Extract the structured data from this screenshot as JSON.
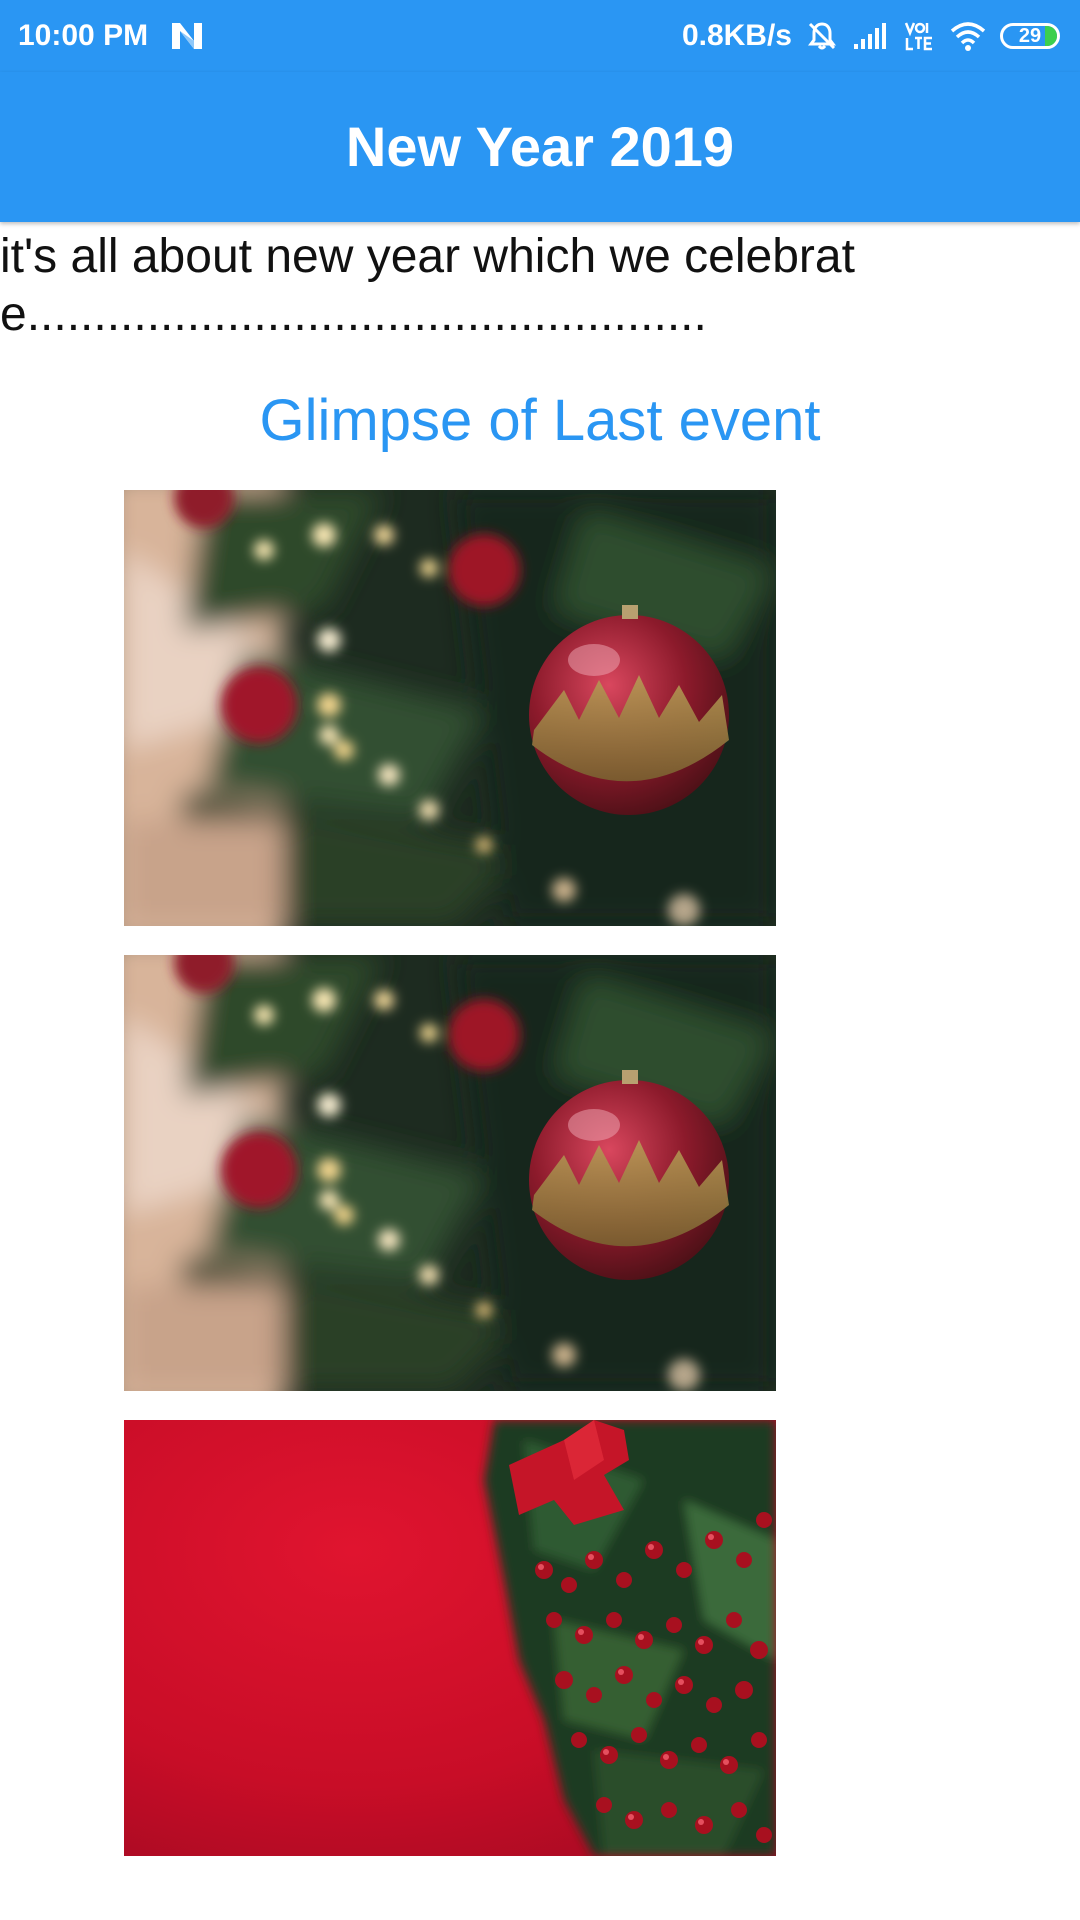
{
  "status_bar": {
    "time": "10:00 PM",
    "network_speed": "0.8KB/s",
    "battery_level": "29",
    "icons": [
      "notification-n-icon",
      "mute-icon",
      "signal-icon",
      "volte-icon",
      "wifi-icon",
      "battery-icon"
    ]
  },
  "app_bar": {
    "title": "New Year 2019"
  },
  "content": {
    "intro_text": "it's all about new year which we celebrate...................................................",
    "section_title": "Glimpse of Last event",
    "photos": [
      {
        "name": "christmas-tree-ornaments-photo"
      },
      {
        "name": "christmas-tree-ornaments-photo"
      },
      {
        "name": "red-berries-wreath-photo"
      }
    ]
  },
  "colors": {
    "primary": "#2a96f3",
    "text": "#111111",
    "background": "#ffffff"
  }
}
